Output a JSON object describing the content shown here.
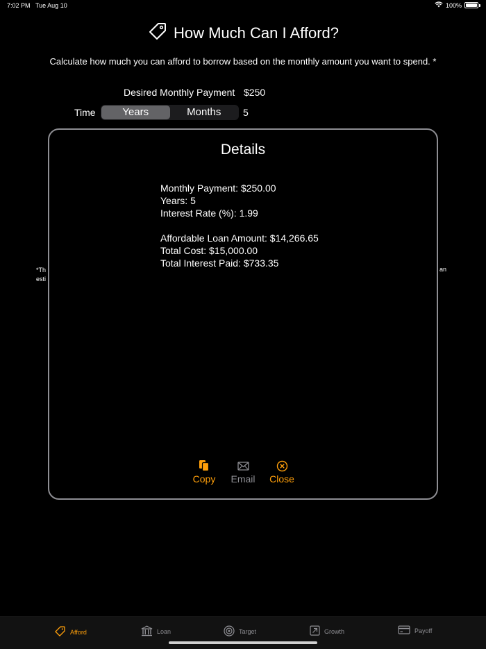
{
  "status": {
    "time": "7:02 PM",
    "date": "Tue Aug 10",
    "battery": "100%"
  },
  "header": {
    "title": "How Much Can I Afford?",
    "subtitle": "Calculate how much you can afford to borrow based on the monthly amount you want to spend. *"
  },
  "form": {
    "payment_label": "Desired Monthly Payment",
    "payment_value": "$250",
    "time_label": "Time",
    "time_options": [
      "Years",
      "Months"
    ],
    "time_selected": "Years",
    "time_value": "5"
  },
  "footnote": {
    "left": "*Th",
    "left_line2": "esti",
    "right": "an"
  },
  "modal": {
    "title": "Details",
    "lines": [
      "Monthly Payment: $250.00",
      "Years: 5",
      "Interest Rate (%): 1.99",
      "",
      "Affordable Loan Amount: $14,266.65",
      "Total Cost: $15,000.00",
      "Total Interest Paid: $733.35"
    ],
    "actions": {
      "copy": "Copy",
      "email": "Email",
      "close": "Close"
    }
  },
  "tabs": [
    {
      "label": "Afford",
      "icon": "tag-icon",
      "active": true
    },
    {
      "label": "Loan",
      "icon": "bank-icon",
      "active": false
    },
    {
      "label": "Target",
      "icon": "target-icon",
      "active": false
    },
    {
      "label": "Growth",
      "icon": "growth-arrow-icon",
      "active": false
    },
    {
      "label": "Payoff",
      "icon": "credit-card-icon",
      "active": false
    }
  ],
  "colors": {
    "accent": "#ff9f0a",
    "inactive": "#8e8e93",
    "background": "#000000"
  }
}
